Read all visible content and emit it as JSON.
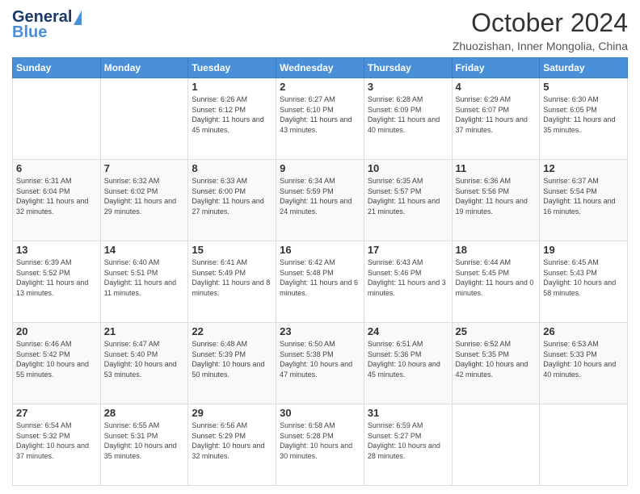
{
  "header": {
    "logo_line1": "General",
    "logo_line2": "Blue",
    "month_title": "October 2024",
    "location": "Zhuozishan, Inner Mongolia, China"
  },
  "weekdays": [
    "Sunday",
    "Monday",
    "Tuesday",
    "Wednesday",
    "Thursday",
    "Friday",
    "Saturday"
  ],
  "weeks": [
    [
      {
        "day": "",
        "info": ""
      },
      {
        "day": "",
        "info": ""
      },
      {
        "day": "1",
        "info": "Sunrise: 6:26 AM\nSunset: 6:12 PM\nDaylight: 11 hours and 45 minutes."
      },
      {
        "day": "2",
        "info": "Sunrise: 6:27 AM\nSunset: 6:10 PM\nDaylight: 11 hours and 43 minutes."
      },
      {
        "day": "3",
        "info": "Sunrise: 6:28 AM\nSunset: 6:09 PM\nDaylight: 11 hours and 40 minutes."
      },
      {
        "day": "4",
        "info": "Sunrise: 6:29 AM\nSunset: 6:07 PM\nDaylight: 11 hours and 37 minutes."
      },
      {
        "day": "5",
        "info": "Sunrise: 6:30 AM\nSunset: 6:05 PM\nDaylight: 11 hours and 35 minutes."
      }
    ],
    [
      {
        "day": "6",
        "info": "Sunrise: 6:31 AM\nSunset: 6:04 PM\nDaylight: 11 hours and 32 minutes."
      },
      {
        "day": "7",
        "info": "Sunrise: 6:32 AM\nSunset: 6:02 PM\nDaylight: 11 hours and 29 minutes."
      },
      {
        "day": "8",
        "info": "Sunrise: 6:33 AM\nSunset: 6:00 PM\nDaylight: 11 hours and 27 minutes."
      },
      {
        "day": "9",
        "info": "Sunrise: 6:34 AM\nSunset: 5:59 PM\nDaylight: 11 hours and 24 minutes."
      },
      {
        "day": "10",
        "info": "Sunrise: 6:35 AM\nSunset: 5:57 PM\nDaylight: 11 hours and 21 minutes."
      },
      {
        "day": "11",
        "info": "Sunrise: 6:36 AM\nSunset: 5:56 PM\nDaylight: 11 hours and 19 minutes."
      },
      {
        "day": "12",
        "info": "Sunrise: 6:37 AM\nSunset: 5:54 PM\nDaylight: 11 hours and 16 minutes."
      }
    ],
    [
      {
        "day": "13",
        "info": "Sunrise: 6:39 AM\nSunset: 5:52 PM\nDaylight: 11 hours and 13 minutes."
      },
      {
        "day": "14",
        "info": "Sunrise: 6:40 AM\nSunset: 5:51 PM\nDaylight: 11 hours and 11 minutes."
      },
      {
        "day": "15",
        "info": "Sunrise: 6:41 AM\nSunset: 5:49 PM\nDaylight: 11 hours and 8 minutes."
      },
      {
        "day": "16",
        "info": "Sunrise: 6:42 AM\nSunset: 5:48 PM\nDaylight: 11 hours and 6 minutes."
      },
      {
        "day": "17",
        "info": "Sunrise: 6:43 AM\nSunset: 5:46 PM\nDaylight: 11 hours and 3 minutes."
      },
      {
        "day": "18",
        "info": "Sunrise: 6:44 AM\nSunset: 5:45 PM\nDaylight: 11 hours and 0 minutes."
      },
      {
        "day": "19",
        "info": "Sunrise: 6:45 AM\nSunset: 5:43 PM\nDaylight: 10 hours and 58 minutes."
      }
    ],
    [
      {
        "day": "20",
        "info": "Sunrise: 6:46 AM\nSunset: 5:42 PM\nDaylight: 10 hours and 55 minutes."
      },
      {
        "day": "21",
        "info": "Sunrise: 6:47 AM\nSunset: 5:40 PM\nDaylight: 10 hours and 53 minutes."
      },
      {
        "day": "22",
        "info": "Sunrise: 6:48 AM\nSunset: 5:39 PM\nDaylight: 10 hours and 50 minutes."
      },
      {
        "day": "23",
        "info": "Sunrise: 6:50 AM\nSunset: 5:38 PM\nDaylight: 10 hours and 47 minutes."
      },
      {
        "day": "24",
        "info": "Sunrise: 6:51 AM\nSunset: 5:36 PM\nDaylight: 10 hours and 45 minutes."
      },
      {
        "day": "25",
        "info": "Sunrise: 6:52 AM\nSunset: 5:35 PM\nDaylight: 10 hours and 42 minutes."
      },
      {
        "day": "26",
        "info": "Sunrise: 6:53 AM\nSunset: 5:33 PM\nDaylight: 10 hours and 40 minutes."
      }
    ],
    [
      {
        "day": "27",
        "info": "Sunrise: 6:54 AM\nSunset: 5:32 PM\nDaylight: 10 hours and 37 minutes."
      },
      {
        "day": "28",
        "info": "Sunrise: 6:55 AM\nSunset: 5:31 PM\nDaylight: 10 hours and 35 minutes."
      },
      {
        "day": "29",
        "info": "Sunrise: 6:56 AM\nSunset: 5:29 PM\nDaylight: 10 hours and 32 minutes."
      },
      {
        "day": "30",
        "info": "Sunrise: 6:58 AM\nSunset: 5:28 PM\nDaylight: 10 hours and 30 minutes."
      },
      {
        "day": "31",
        "info": "Sunrise: 6:59 AM\nSunset: 5:27 PM\nDaylight: 10 hours and 28 minutes."
      },
      {
        "day": "",
        "info": ""
      },
      {
        "day": "",
        "info": ""
      }
    ]
  ]
}
